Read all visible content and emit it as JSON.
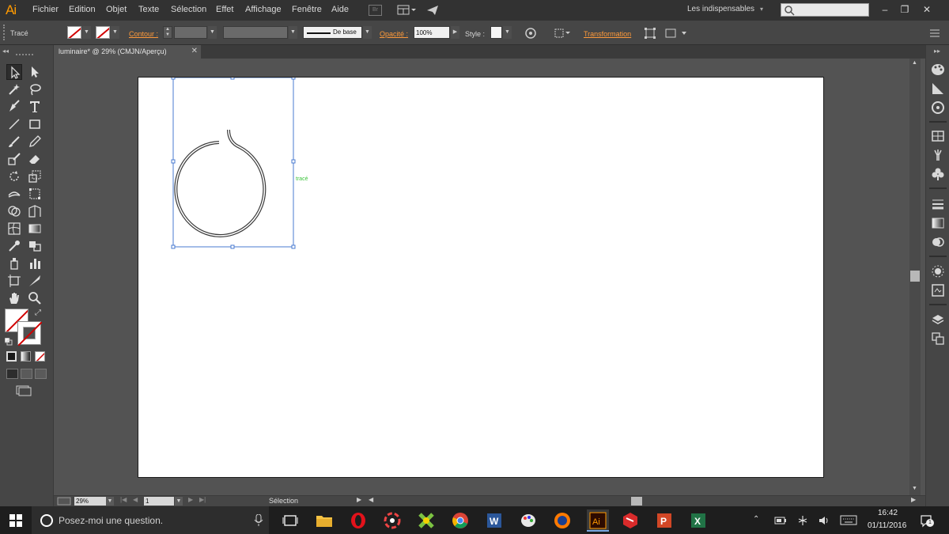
{
  "app": {
    "logo": "Ai",
    "menu": [
      "Fichier",
      "Edition",
      "Objet",
      "Texte",
      "Sélection",
      "Effet",
      "Affichage",
      "Fenêtre",
      "Aide"
    ],
    "bridge_label": "Br",
    "workspace": "Les indispensables",
    "search_placeholder": ""
  },
  "controlbar": {
    "selection_type": "Tracé",
    "stroke_label": "Contour :",
    "profile_label": "De base",
    "opacity_label": "Opacité :",
    "opacity_value": "100%",
    "style_label": "Style :",
    "transform_label": "Transformation"
  },
  "document": {
    "tab_title": "luminaire* @ 29% (CMJN/Aperçu)",
    "path_hint": "tracé"
  },
  "status": {
    "zoom": "29%",
    "page": "1",
    "mode": "Sélection"
  },
  "taskbar": {
    "search_placeholder": "Posez-moi une question.",
    "time": "16:42",
    "date": "01/11/2016",
    "notifications": "1",
    "apps": [
      "task-view",
      "file-explorer",
      "opera",
      "media",
      "xnview",
      "chrome",
      "word",
      "paint",
      "firefox",
      "illustrator",
      "sketchup",
      "powerpoint",
      "excel"
    ]
  },
  "colors": {
    "accent": "#ff9a00",
    "selection": "#4a7bd0",
    "hint": "#3ec43e",
    "ui_dark": "#323232",
    "ui_mid": "#464646",
    "pasteboard": "#535353"
  }
}
